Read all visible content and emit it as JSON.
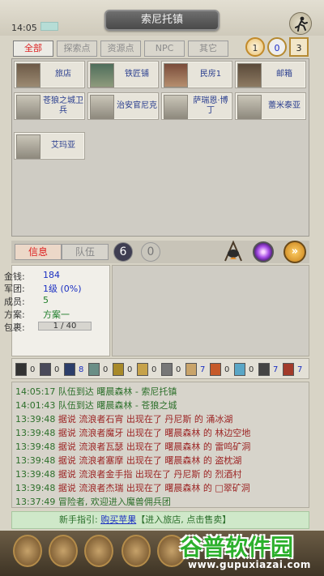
{
  "status": {
    "time": "14:05"
  },
  "header": {
    "title": "索尼托镇"
  },
  "tabs": [
    "全部",
    "探索点",
    "资源点",
    "NPC",
    "其它"
  ],
  "resources": {
    "a": "1",
    "b": "0",
    "c": "3"
  },
  "npcs": [
    {
      "label": "旅店"
    },
    {
      "label": "铁匠铺"
    },
    {
      "label": "民房1"
    },
    {
      "label": "邮箱"
    },
    {
      "label": "苍狼之城卫兵"
    },
    {
      "label": "治安官尼克"
    },
    {
      "label": "萨瑞恩·博丁"
    },
    {
      "label": "蕾米泰亚"
    },
    {
      "label": "艾玛亚"
    }
  ],
  "midbar": {
    "info_tab": "信息",
    "team_tab": "队伍",
    "count_a": "6",
    "count_b": "0",
    "fwd": "»"
  },
  "info": {
    "money_label": "金钱:",
    "money": "184",
    "legion_label": "军团:",
    "legion": "1级 (0%)",
    "members_label": "成员:",
    "members": "5",
    "plan_label": "方案:",
    "plan": "方案一",
    "bag_label": "包裹:",
    "bag": "1 / 40"
  },
  "items": [
    "0",
    "0",
    "8",
    "0",
    "0",
    "0",
    "0",
    "7",
    "0",
    "0",
    "7",
    "7"
  ],
  "log": [
    {
      "time": "14:05:17",
      "text": "队伍到达  曙晨森林 - 索尼托镇",
      "color": "green"
    },
    {
      "time": "14:01:43",
      "text": "队伍到达  曙晨森林 - 苍狼之城",
      "color": "green"
    },
    {
      "time": "13:39:48",
      "text": "据说 流浪者石宵 出现在了 丹尼斯 的 涌冰湖",
      "color": "red"
    },
    {
      "time": "13:39:48",
      "text": "据说 流浪者魔牙 出现在了 曙晨森林 的 林边空地",
      "color": "red"
    },
    {
      "time": "13:39:48",
      "text": "据说 流浪者瓦瑟 出现在了 曙晨森林 的 雷鸣矿洞",
      "color": "red"
    },
    {
      "time": "13:39:48",
      "text": "据说 流浪者塞摩 出现在了 曙晨森林 的 盗枕湖",
      "color": "red"
    },
    {
      "time": "13:39:48",
      "text": "据说 流浪者金手指 出现在了 丹尼斯 的 烈酒村",
      "color": "red"
    },
    {
      "time": "13:39:48",
      "text": "据说 流浪者杰瑞 出现在了 曙晨森林 的 □翠矿洞",
      "color": "red"
    },
    {
      "time": "13:37:49",
      "text": "冒险者, 欢迎进入魔兽佣兵团",
      "color": "green"
    }
  ],
  "guide": {
    "label": "新手指引:",
    "link": "购买苹果",
    "rest": "【进入旅店, 点击售卖】"
  },
  "watermark": {
    "title": "谷普软件园",
    "url": "www.gupuxiazai.com"
  },
  "colors": {
    "accent_red": "#d22222",
    "link_blue": "#1a2fc2",
    "log_green": "#2c6f2a",
    "log_red": "#9c2424"
  }
}
